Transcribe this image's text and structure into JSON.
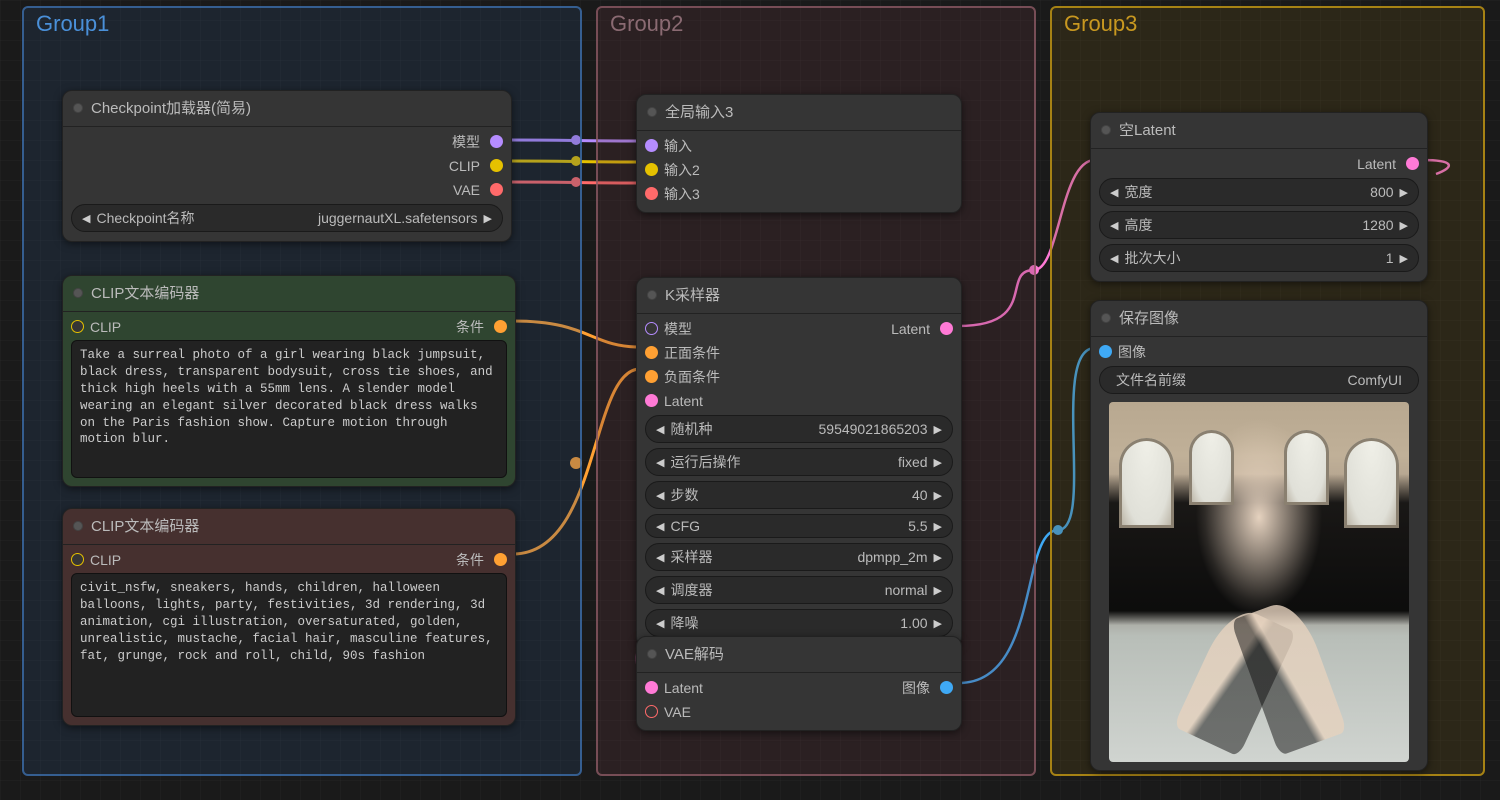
{
  "groups": {
    "g1": {
      "title": "Group1"
    },
    "g2": {
      "title": "Group2"
    },
    "g3": {
      "title": "Group3"
    }
  },
  "checkpoint": {
    "title": "Checkpoint加载器(简易)",
    "out_model": "模型",
    "out_clip": "CLIP",
    "out_vae": "VAE",
    "widget_label": "Checkpoint名称",
    "widget_value": "juggernautXL.safetensors"
  },
  "clip_pos": {
    "title": "CLIP文本编码器",
    "in_clip": "CLIP",
    "out_cond": "条件",
    "text": "Take a surreal photo of a girl wearing black jumpsuit, black dress, transparent bodysuit, cross tie shoes, and thick high heels with a 55mm lens. A slender model wearing an elegant silver decorated black dress walks on the Paris fashion show. Capture motion through motion blur."
  },
  "clip_neg": {
    "title": "CLIP文本编码器",
    "in_clip": "CLIP",
    "out_cond": "条件",
    "text": "civit_nsfw, sneakers, hands, children, halloween balloons, lights, party, festivities, 3d rendering, 3d animation, cgi illustration, oversaturated, golden, unrealistic, mustache, facial hair, masculine features, fat, grunge, rock and roll, child, 90s fashion"
  },
  "global_input": {
    "title": "全局输入3",
    "in1": "输入",
    "in2": "输入2",
    "in3": "输入3"
  },
  "ksampler": {
    "title": "K采样器",
    "in_model": "模型",
    "in_pos": "正面条件",
    "in_neg": "负面条件",
    "in_latent": "Latent",
    "out_latent": "Latent",
    "w": {
      "seed_label": "随机种",
      "seed_value": "59549021865203",
      "after_label": "运行后操作",
      "after_value": "fixed",
      "steps_label": "步数",
      "steps_value": "40",
      "cfg_label": "CFG",
      "cfg_value": "5.5",
      "sampler_label": "采样器",
      "sampler_value": "dpmpp_2m",
      "scheduler_label": "调度器",
      "scheduler_value": "normal",
      "denoise_label": "降噪",
      "denoise_value": "1.00"
    }
  },
  "vae_decode": {
    "title": "VAE解码",
    "in_latent": "Latent",
    "in_vae": "VAE",
    "out_image": "图像"
  },
  "empty_latent": {
    "title": "空Latent",
    "out_latent": "Latent",
    "w": {
      "width_label": "宽度",
      "width_value": "800",
      "height_label": "高度",
      "height_value": "1280",
      "batch_label": "批次大小",
      "batch_value": "1"
    }
  },
  "save_image": {
    "title": "保存图像",
    "in_image": "图像",
    "w": {
      "prefix_label": "文件名前缀",
      "prefix_value": "ComfyUI"
    }
  }
}
